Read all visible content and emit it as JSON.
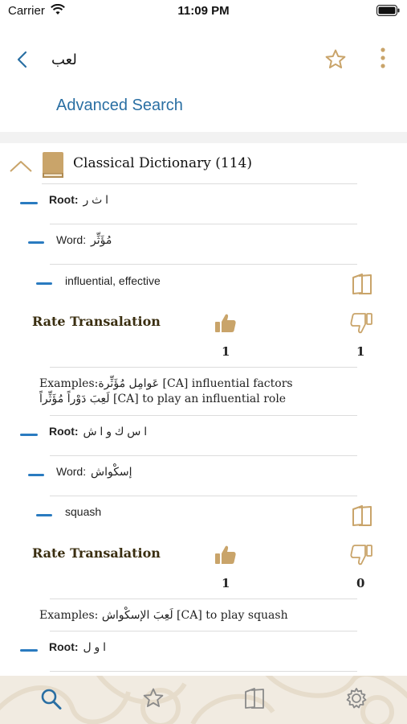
{
  "status_bar": {
    "carrier": "Carrier",
    "time": "11:09 PM"
  },
  "nav": {
    "title": "لعب"
  },
  "advanced_search_label": "Advanced Search",
  "section": {
    "title": "Classical Dictionary (114)"
  },
  "entries": [
    {
      "root_label": "Root:",
      "root_value": "ا ث ر",
      "word_label": "Word:",
      "word_value": "مُؤَثِّر",
      "meaning": "influential, effective",
      "rate_label": "Rate Transalation",
      "up_count": "1",
      "down_count": "1",
      "examples_label": "Examples:",
      "example_lines": [
        "عَوامِل مُؤَثِّرة [CA] influential factors",
        "لَعِبَ دَوْراً مُؤَثِّراً [CA] to play an influential role"
      ]
    },
    {
      "root_label": "Root:",
      "root_value": "ا س ك و ا ش",
      "word_label": "Word:",
      "word_value": "إسكْواش",
      "meaning": "squash",
      "rate_label": "Rate Transalation",
      "up_count": "1",
      "down_count": "0",
      "examples_label": "Examples:",
      "example_lines": [
        "لَعِبَ الإسكْواش [CA] to play squash"
      ]
    },
    {
      "root_label": "Root:",
      "root_value": "ا و ل"
    }
  ],
  "colors": {
    "accent_blue": "#2a7bc0",
    "link_blue": "#2a6fa3",
    "tan": "#c9a46a",
    "brown_text": "#3a2e10",
    "tab_bg": "#f1ebe1"
  },
  "tabs": [
    {
      "icon": "search-icon",
      "active": true
    },
    {
      "icon": "star-icon",
      "active": false
    },
    {
      "icon": "book-icon",
      "active": false
    },
    {
      "icon": "gear-icon",
      "active": false
    }
  ]
}
